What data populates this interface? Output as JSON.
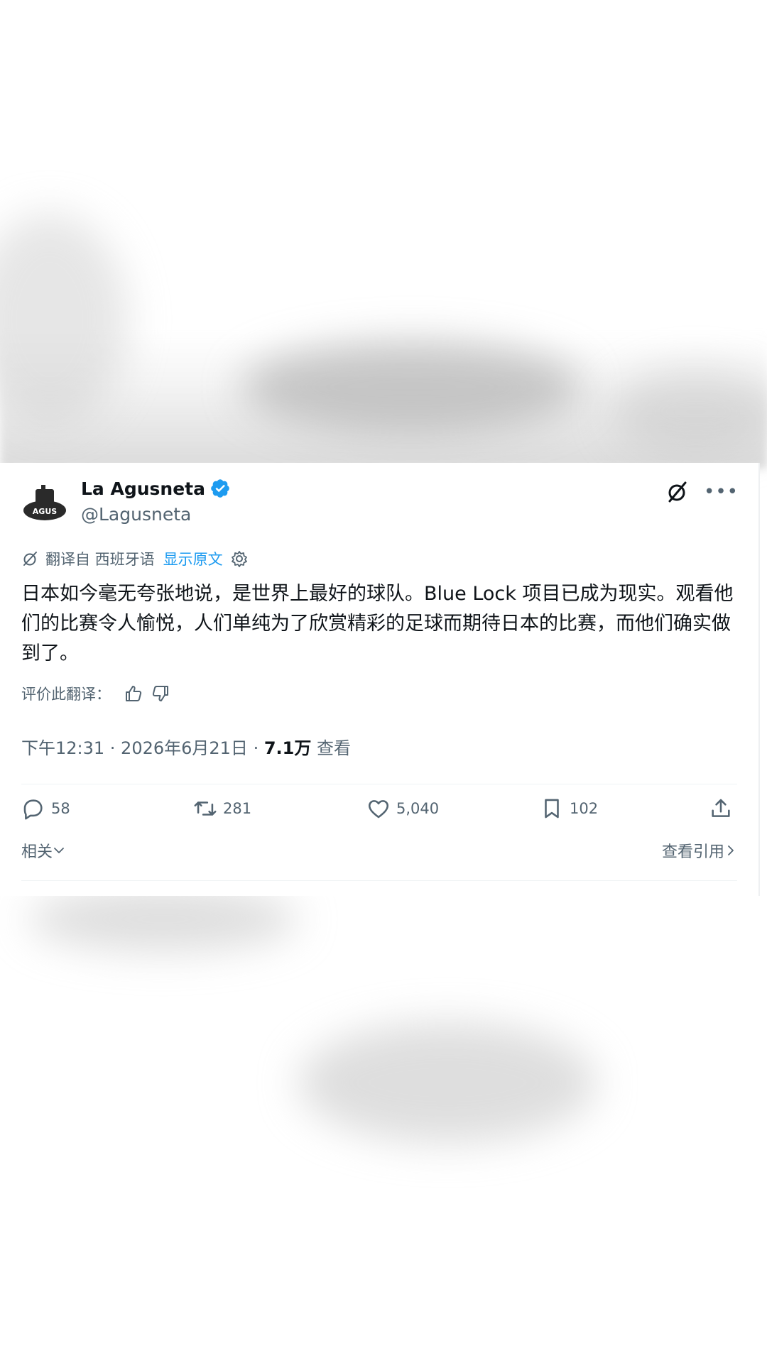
{
  "author": {
    "name": "La Agusneta",
    "handle": "@Lagusneta"
  },
  "translation": {
    "from_label": "翻译自 西班牙语",
    "show_original": "显示原文"
  },
  "tweet_text": "日本如今毫无夸张地说，是世界上最好的球队。Blue Lock 项目已成为现实。观看他们的比赛令人愉悦，人们单纯为了欣赏精彩的足球而期待日本的比赛，而他们确实做到了。",
  "rate_translation_label": "评价此翻译：",
  "meta": {
    "time_date": "下午12:31 · 2026年6月21日 · ",
    "views": "7.1万",
    "views_label": " 查看"
  },
  "stats": {
    "replies": "58",
    "retweets": "281",
    "likes": "5,040",
    "bookmarks": "102"
  },
  "related_label": "相关",
  "view_quotes_label": "查看引用",
  "colors": {
    "accent": "#1d9bf0",
    "secondary_text": "#536471",
    "primary_text": "#0f1419"
  }
}
